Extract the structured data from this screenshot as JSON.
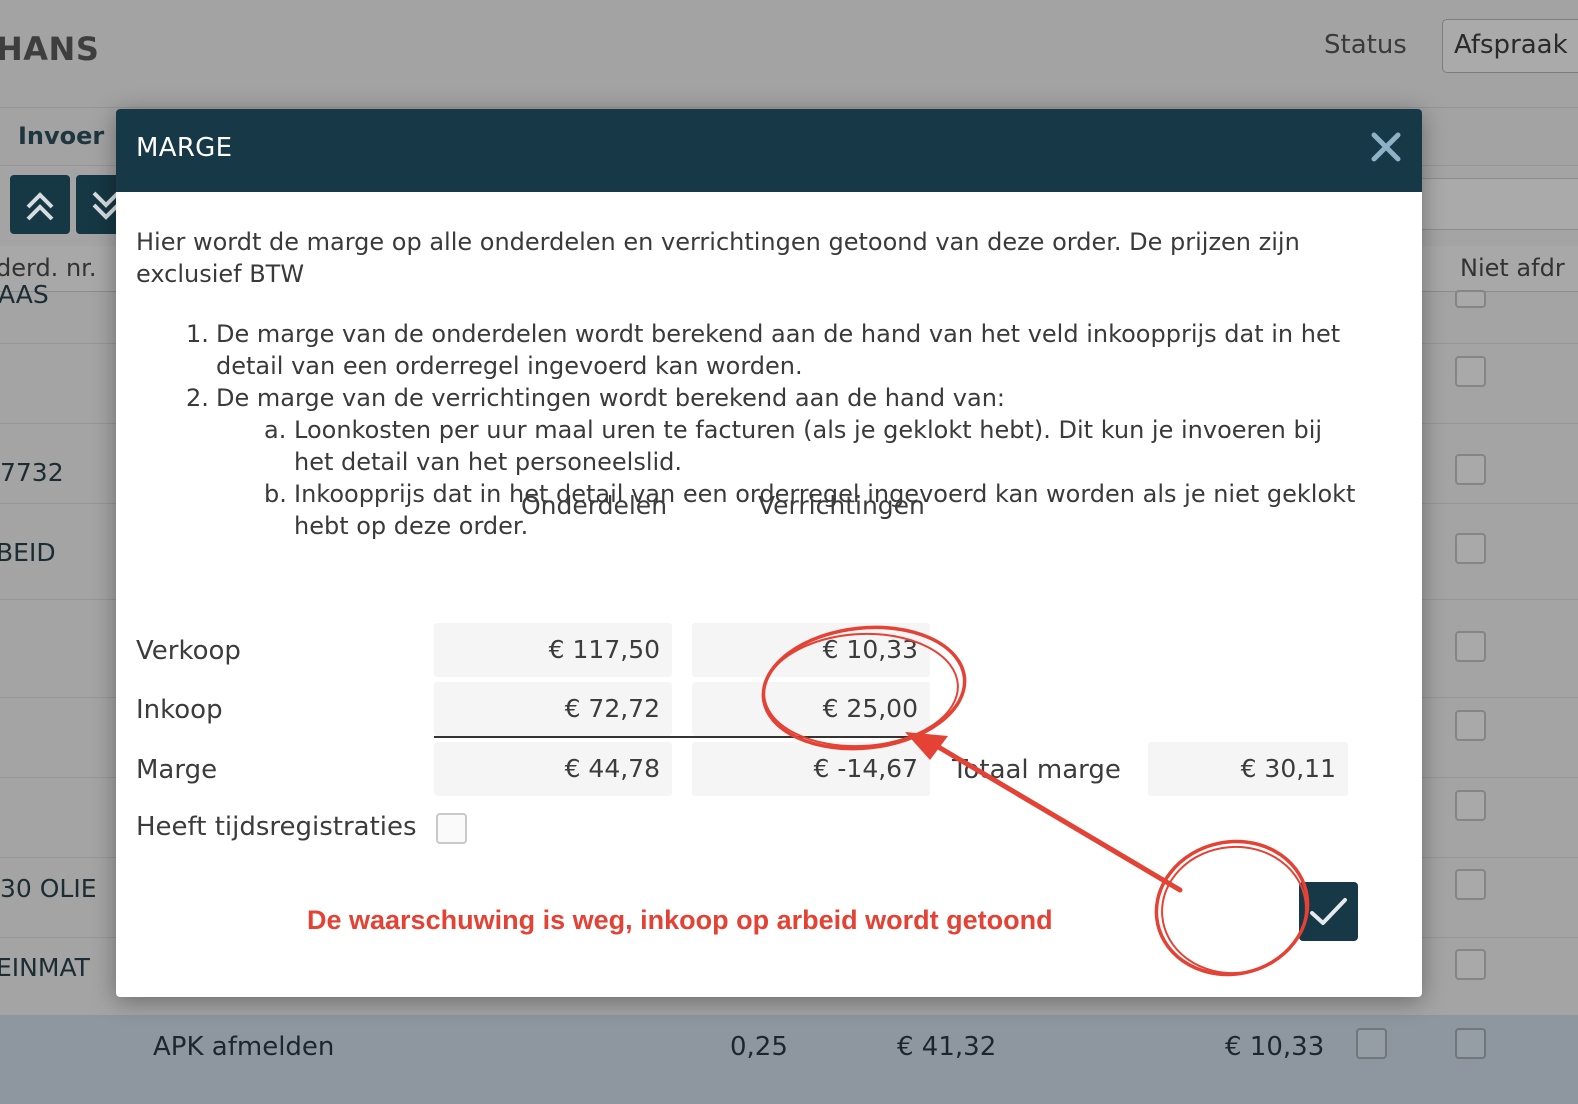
{
  "background": {
    "title": "HANS",
    "status_label": "Status",
    "status_value": "Afspraak",
    "tab_label": "Invoer",
    "column_headers": {
      "onderdeel_nr": "derd. nr.",
      "niet_afdrukken": "Niet afdr"
    },
    "row_texts": [
      "AAS",
      "7732",
      "BEID",
      "30 OLIE",
      "EINMAT"
    ],
    "apk_row": {
      "description": "APK afmelden",
      "quantity": "0,25",
      "price": "€ 41,32",
      "total": "€ 10,33"
    }
  },
  "modal": {
    "title": "MARGE",
    "intro": "Hier wordt de marge op alle onderdelen en verrichtingen getoond van deze order. De prijzen zijn exclusief BTW",
    "list": [
      {
        "num": "1.",
        "text": "De marge van de onderdelen wordt berekend aan de hand van het veld inkoopprijs dat in het detail van een orderregel ingevoerd kan worden."
      },
      {
        "num": "2.",
        "text": "De marge van de verrichtingen wordt berekend aan de hand van:"
      }
    ],
    "sublist": [
      {
        "num": "a.",
        "text": "Loonkosten per uur maal uren te facturen (als je geklokt hebt). Dit kun je invoeren bij het detail van het personeelslid."
      },
      {
        "num": "b.",
        "text": "Inkoopprijs dat in het detail van een orderregel ingevoerd kan worden als je niet geklokt hebt op deze order."
      }
    ],
    "columns": {
      "parts": "Onderdelen",
      "labour": "Verrichtingen"
    },
    "rows": {
      "sale": {
        "label": "Verkoop",
        "parts": "€ 117,50",
        "labour": "€ 10,33"
      },
      "purchase": {
        "label": "Inkoop",
        "parts": "€ 72,72",
        "labour": "€ 25,00"
      },
      "margin": {
        "label": "Marge",
        "parts": "€ 44,78",
        "labour": "€ -14,67"
      }
    },
    "total_margin_label": "Totaal marge",
    "total_margin_value": "€ 30,11",
    "time_registrations_label": "Heeft tijdsregistraties",
    "time_registrations_checked": false
  },
  "annotation": {
    "text": "De waarschuwing is weg, inkoop op arbeid wordt getoond",
    "color": "#e34234"
  },
  "colors": {
    "header": "#163847",
    "accent_red": "#e34234"
  }
}
